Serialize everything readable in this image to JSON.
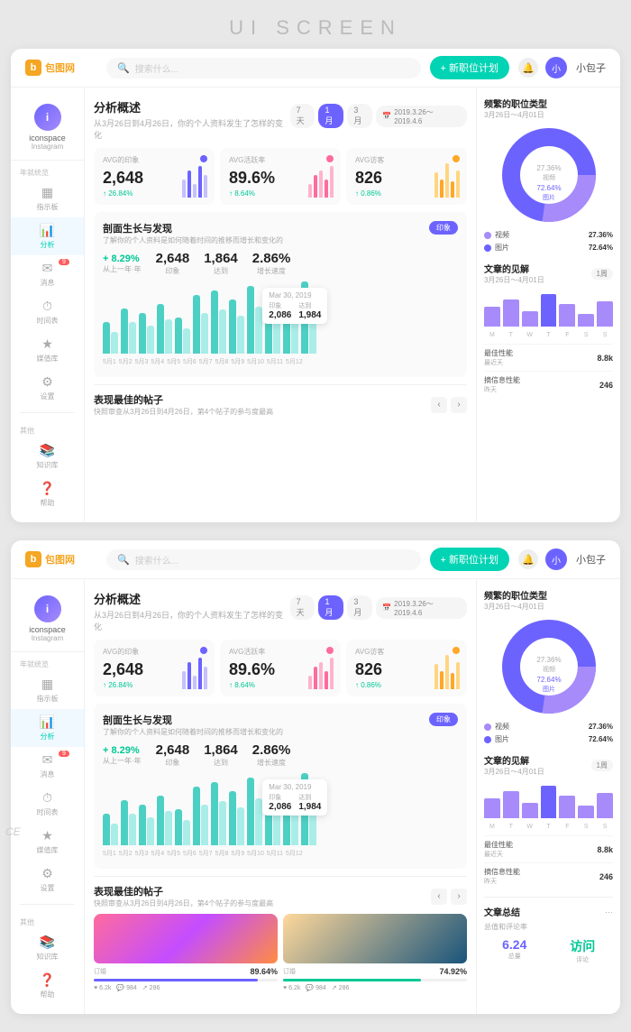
{
  "pageTitle": "UI SCREEN",
  "watermark": "CE",
  "topnav": {
    "logoText": "包图网",
    "searchPlaceholder": "搜索什么...",
    "newJobBtn": "+ 新职位计划",
    "userName": "小包子"
  },
  "sidebar": {
    "user": {
      "initial": "i",
      "name": "iconspace",
      "sub": "Instagram"
    },
    "sectionLabel1": "年就统览",
    "items": [
      {
        "icon": "▦",
        "label": "指示板",
        "active": false,
        "badge": ""
      },
      {
        "icon": "📊",
        "label": "分析",
        "active": true,
        "badge": ""
      },
      {
        "icon": "✉",
        "label": "消息",
        "active": false,
        "badge": "9"
      },
      {
        "icon": "⏱",
        "label": "时间表",
        "active": false,
        "badge": ""
      },
      {
        "icon": "★",
        "label": "媒值库",
        "active": false,
        "badge": ""
      },
      {
        "icon": "⚙",
        "label": "设置",
        "active": false,
        "badge": ""
      }
    ],
    "sectionLabel2": "其他",
    "items2": [
      {
        "icon": "📚",
        "label": "知识库",
        "active": false
      },
      {
        "icon": "❓",
        "label": "帮助",
        "active": false
      }
    ]
  },
  "analysis": {
    "title": "分析概述",
    "subtitle": "从3月26日到4月26日，你的个人资料发生了怎样的变化",
    "timeFilters": [
      "7天",
      "1月",
      "3月"
    ],
    "activeFilter": "1月",
    "dateRange": "2019.3.26～2019.4.6",
    "stats": [
      {
        "label": "AVG的印象",
        "value": "2,648",
        "change": "↑ 26.84%",
        "changeType": "positive",
        "dotColor": "#6c63ff",
        "bars": [
          30,
          45,
          25,
          55,
          35,
          60,
          40,
          50
        ]
      },
      {
        "label": "AVG活跃率",
        "value": "89.6%",
        "change": "↑ 8.64%",
        "changeType": "positive",
        "dotColor": "#ff6b9d",
        "bars": [
          20,
          35,
          45,
          30,
          50,
          25,
          40,
          55
        ]
      },
      {
        "label": "AVG访客",
        "value": "826",
        "change": "↑ 0.86%",
        "changeType": "positive",
        "dotColor": "#ffa726",
        "bars": [
          40,
          30,
          55,
          25,
          45,
          35,
          50,
          30
        ]
      }
    ]
  },
  "growth": {
    "title": "剖面生长与发现",
    "subtitle": "了解你的个人资料是如何随着时间的推移而增长和变化的",
    "badge": "印象",
    "changePercent": "+ 8.29%",
    "changeSub": "从上一年·年",
    "metrics": [
      {
        "value": "2,648",
        "label": "印象"
      },
      {
        "value": "1,864",
        "label": "达到"
      },
      {
        "value": "2.86%",
        "label": "增长速度"
      }
    ],
    "tooltip": {
      "date": "Mar 30, 2019",
      "values": [
        {
          "label": "印象",
          "val": "2,086"
        },
        {
          "label": "达到",
          "val": "1,984"
        }
      ]
    },
    "chartBars": [
      35,
      50,
      45,
      55,
      40,
      65,
      70,
      60,
      75,
      55,
      65,
      80
    ],
    "chartLabels": [
      "5月1",
      "5月2",
      "5月3",
      "5月4",
      "5月5",
      "5月6",
      "5月7",
      "5月8",
      "5月9",
      "5月10",
      "5月11",
      "5月12"
    ]
  },
  "posts": {
    "title": "表现最佳的帖子",
    "subtitle": "快照审查从3月26日到4月26日，第4个帖子的参与度最高",
    "items": [
      {
        "metricLabel": "订婚",
        "metricValue": "89.64%",
        "progressWidth": 89,
        "progressColor": "#6c63ff",
        "stats": [
          {
            "icon": "♥",
            "val": "6.2k"
          },
          {
            "icon": "💬",
            "val": "984"
          },
          {
            "icon": "↗",
            "val": "286"
          }
        ]
      },
      {
        "metricLabel": "订婚",
        "metricValue": "74.92%",
        "progressWidth": 75,
        "progressColor": "#00c896",
        "stats": [
          {
            "icon": "♥",
            "val": "6.2k"
          },
          {
            "icon": "💬",
            "val": "984"
          },
          {
            "icon": "↗",
            "val": "286"
          }
        ]
      }
    ]
  },
  "rightPanel": {
    "jobTypes": {
      "title": "频繁的职位类型",
      "subtitle": "3月26日～4月01日",
      "donut": [
        {
          "label": "视频",
          "percent": 27.36,
          "color": "#a78bfa"
        },
        {
          "label": "图片",
          "percent": 72.64,
          "color": "#6c63ff"
        }
      ]
    },
    "insights": {
      "title": "文章的见解",
      "subtitle": "3月26日～4月01日",
      "period": "1周",
      "dayLabels": [
        "M",
        "T",
        "W",
        "T",
        "F",
        "S",
        "S"
      ],
      "bars": [
        40,
        55,
        30,
        65,
        45,
        25,
        50
      ],
      "barColors": [
        "#a78bfa",
        "#a78bfa",
        "#a78bfa",
        "#6c63ff",
        "#a78bfa",
        "#a78bfa",
        "#a78bfa"
      ],
      "metrics": [
        {
          "name": "最佳性能",
          "sub": "最近天",
          "val": "8.8k"
        },
        {
          "name": "摘信息性能",
          "sub": "昨天",
          "val": "246"
        }
      ]
    }
  }
}
